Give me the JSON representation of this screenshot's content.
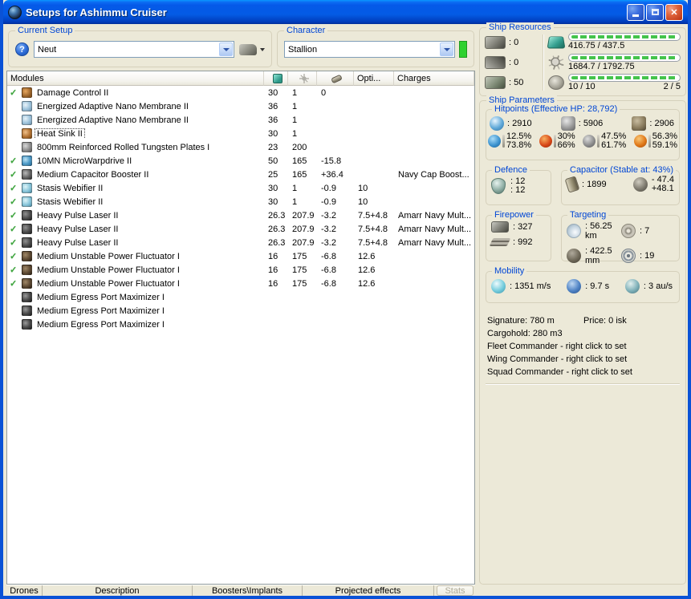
{
  "window": {
    "title": "Setups for Ashimmu Cruiser"
  },
  "titlebar": {
    "minimize": "minimize",
    "maximize": "maximize",
    "close": "✕"
  },
  "colors": {
    "titlebar_blue": "#0559E8",
    "caption_blue": "#0046D5",
    "bar_green": "#44C34C",
    "check_green": "#3BA33B",
    "character_active_green": "#2FD12F"
  },
  "current_setup": {
    "label": "Current Setup",
    "value": "Neut",
    "help": "?"
  },
  "character": {
    "label": "Character",
    "value": "Stallion"
  },
  "modules_table": {
    "headers": {
      "modules": "Modules",
      "cpu_icon": "cpu",
      "pg_icon": "powergrid",
      "cap_icon": "capacitor",
      "opti": "Opti...",
      "charges": "Charges"
    },
    "rows": [
      {
        "check": true,
        "icon": "damage-control",
        "name": "Damage Control II",
        "cpu": "30",
        "pg": "1",
        "cap": "0",
        "opti": "",
        "charges": ""
      },
      {
        "check": false,
        "icon": "nano-membrane",
        "name": "Energized Adaptive Nano Membrane II",
        "cpu": "36",
        "pg": "1",
        "cap": "",
        "opti": "",
        "charges": ""
      },
      {
        "check": false,
        "icon": "nano-membrane",
        "name": "Energized Adaptive Nano Membrane II",
        "cpu": "36",
        "pg": "1",
        "cap": "",
        "opti": "",
        "charges": ""
      },
      {
        "check": false,
        "icon": "heat-sink",
        "name": "Heat Sink II",
        "cpu": "30",
        "pg": "1",
        "cap": "",
        "opti": "",
        "charges": "",
        "selected": true
      },
      {
        "check": false,
        "icon": "armor-plate",
        "name": "800mm Reinforced Rolled Tungsten Plates I",
        "cpu": "23",
        "pg": "200",
        "cap": "",
        "opti": "",
        "charges": ""
      },
      {
        "check": true,
        "icon": "mwd",
        "name": "10MN MicroWarpdrive II",
        "cpu": "50",
        "pg": "165",
        "cap": "-15.8",
        "opti": "",
        "charges": ""
      },
      {
        "check": true,
        "icon": "cap-booster",
        "name": "Medium Capacitor Booster II",
        "cpu": "25",
        "pg": "165",
        "cap": "+36.4",
        "opti": "",
        "charges": "Navy Cap Boost..."
      },
      {
        "check": true,
        "icon": "webifier",
        "name": "Stasis Webifier II",
        "cpu": "30",
        "pg": "1",
        "cap": "-0.9",
        "opti": "10",
        "charges": ""
      },
      {
        "check": true,
        "icon": "webifier",
        "name": "Stasis Webifier II",
        "cpu": "30",
        "pg": "1",
        "cap": "-0.9",
        "opti": "10",
        "charges": ""
      },
      {
        "check": true,
        "icon": "pulse-laser",
        "name": "Heavy Pulse Laser II",
        "cpu": "26.3",
        "pg": "207.9",
        "cap": "-3.2",
        "opti": "7.5+4.8",
        "charges": "Amarr Navy Mult..."
      },
      {
        "check": true,
        "icon": "pulse-laser",
        "name": "Heavy Pulse Laser II",
        "cpu": "26.3",
        "pg": "207.9",
        "cap": "-3.2",
        "opti": "7.5+4.8",
        "charges": "Amarr Navy Mult..."
      },
      {
        "check": true,
        "icon": "pulse-laser",
        "name": "Heavy Pulse Laser II",
        "cpu": "26.3",
        "pg": "207.9",
        "cap": "-3.2",
        "opti": "7.5+4.8",
        "charges": "Amarr Navy Mult..."
      },
      {
        "check": true,
        "icon": "power-fluctuator",
        "name": "Medium Unstable Power Fluctuator I",
        "cpu": "16",
        "pg": "175",
        "cap": "-6.8",
        "opti": "12.6",
        "charges": ""
      },
      {
        "check": true,
        "icon": "power-fluctuator",
        "name": "Medium Unstable Power Fluctuator I",
        "cpu": "16",
        "pg": "175",
        "cap": "-6.8",
        "opti": "12.6",
        "charges": ""
      },
      {
        "check": true,
        "icon": "power-fluctuator",
        "name": "Medium Unstable Power Fluctuator I",
        "cpu": "16",
        "pg": "175",
        "cap": "-6.8",
        "opti": "12.6",
        "charges": ""
      },
      {
        "check": false,
        "icon": "egress-port",
        "name": "Medium Egress Port Maximizer I",
        "cpu": "",
        "pg": "",
        "cap": "",
        "opti": "",
        "charges": ""
      },
      {
        "check": false,
        "icon": "egress-port",
        "name": "Medium Egress Port Maximizer I",
        "cpu": "",
        "pg": "",
        "cap": "",
        "opti": "",
        "charges": ""
      },
      {
        "check": false,
        "icon": "egress-port",
        "name": "Medium Egress Port Maximizer I",
        "cpu": "",
        "pg": "",
        "cap": "",
        "opti": "",
        "charges": ""
      }
    ]
  },
  "ship_resources": {
    "title": "Ship Resources",
    "slots": [
      {
        "icon": "turret-hardpoint",
        "value": ": 0"
      },
      {
        "icon": "launcher-hardpoint",
        "value": ": 0"
      },
      {
        "icon": "rig-slot",
        "value": ": 50"
      }
    ],
    "bars": [
      {
        "icon": "cpu",
        "text": "416.75 / 437.5",
        "right": ""
      },
      {
        "icon": "powergrid",
        "text": "1684.7 / 1792.75",
        "right": ""
      },
      {
        "icon": "upgrades",
        "text": "10 / 10",
        "right": "2 / 5"
      }
    ]
  },
  "ship_parameters": {
    "title": "Ship Parameters",
    "hitpoints": {
      "title": "Hitpoints (Effective HP: 28,792)",
      "hp": [
        {
          "icon": "shield",
          "value": ": 2910"
        },
        {
          "icon": "armor",
          "value": ": 5906"
        },
        {
          "icon": "structure",
          "value": ": 2906"
        }
      ],
      "resists": [
        {
          "icon": "em-resist",
          "top": "12.5%",
          "bottom": "73.8%"
        },
        {
          "icon": "thermal-resist",
          "top": "30%",
          "bottom": "66%"
        },
        {
          "icon": "kinetic-resist",
          "top": "47.5%",
          "bottom": "61.7%"
        },
        {
          "icon": "explosive-resist",
          "top": "56.3%",
          "bottom": "59.1%"
        }
      ]
    },
    "defence": {
      "title": "Defence",
      "line1": ": 12",
      "line2": ": 12"
    },
    "capacitor": {
      "title": "Capacitor (Stable at: 43%)",
      "amount": ": 1899",
      "drain_top": "- 47.4",
      "drain_bottom": "+48.1"
    },
    "firepower": {
      "title": "Firepower",
      "items": [
        {
          "icon": "turret-firepower",
          "value": ": 327"
        },
        {
          "icon": "volley",
          "value": ": 992"
        }
      ]
    },
    "targeting": {
      "title": "Targeting",
      "items": [
        {
          "icon": "targeting-range",
          "value": ": 56.25 km"
        },
        {
          "icon": "sensor-strength",
          "value": ": 7"
        },
        {
          "icon": "signature-resolution",
          "value": ": 422.5 mm"
        },
        {
          "icon": "max-locked-targets",
          "value": ": 19"
        }
      ]
    },
    "mobility": {
      "title": "Mobility",
      "items": [
        {
          "icon": "max-velocity",
          "value": ": 1351 m/s"
        },
        {
          "icon": "align-time",
          "value": ": 9.7 s"
        },
        {
          "icon": "warp-speed",
          "value": ": 3 au/s"
        }
      ]
    },
    "info": {
      "signature": "Signature: 780 m",
      "price": "Price: 0 isk",
      "cargohold": "Cargohold: 280 m3",
      "fleet": "Fleet Commander - right click to set",
      "wing": "Wing Commander - right click to set",
      "squad": "Squad Commander - right click to set"
    }
  },
  "bottom": {
    "tabs": [
      "Drones",
      "Description",
      "Boosters\\Implants",
      "Projected effects"
    ],
    "stats_label": "Stats"
  }
}
